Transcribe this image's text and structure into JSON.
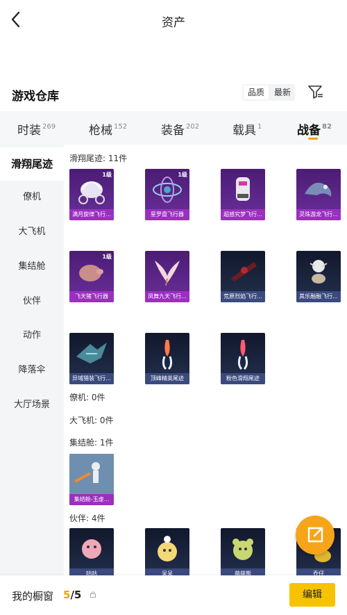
{
  "header": {
    "title": "资产"
  },
  "warehouse": {
    "title": "游戏仓库",
    "sort_quality": "品质",
    "sort_latest": "最新"
  },
  "tabs": [
    {
      "label": "时装",
      "count": "269"
    },
    {
      "label": "枪械",
      "count": "152"
    },
    {
      "label": "装备",
      "count": "202"
    },
    {
      "label": "载具",
      "count": "1"
    },
    {
      "label": "战备",
      "count": "82"
    }
  ],
  "sidebar": [
    {
      "label": "滑翔尾迹"
    },
    {
      "label": "僚机"
    },
    {
      "label": "大飞机"
    },
    {
      "label": "集结舱"
    },
    {
      "label": "伙伴"
    },
    {
      "label": "动作"
    },
    {
      "label": "降落伞"
    },
    {
      "label": "大厅场景"
    }
  ],
  "sections": {
    "glide_trail": "滑翔尾迹: 11件",
    "wingman": "僚机: 0件",
    "big_plane": "大飞机: 0件",
    "assembly_pod": "集结舱: 1件",
    "partner": "伙伴: 4件"
  },
  "items": [
    {
      "name": "满月旋律飞行...",
      "level": "1级"
    },
    {
      "name": "星罗盘飞行器",
      "level": "1级"
    },
    {
      "name": "超感究梦飞行...",
      "level": ""
    },
    {
      "name": "灵珠游龙飞行...",
      "level": ""
    },
    {
      "name": "飞天猪飞行器",
      "level": "1级"
    },
    {
      "name": "凤舞九天飞行...",
      "level": ""
    },
    {
      "name": "荒原烈焰飞行...",
      "level": ""
    },
    {
      "name": "其乐融融飞行...",
      "level": ""
    },
    {
      "name": "异域猎装飞行...",
      "level": ""
    },
    {
      "name": "顶峰精英尾迹",
      "level": ""
    },
    {
      "name": "粉色滑翔尾迹",
      "level": ""
    },
    {
      "name": "集结舱-玉虚...",
      "level": ""
    },
    {
      "name": "咕咕",
      "level": ""
    },
    {
      "name": "呆呆",
      "level": ""
    },
    {
      "name": "萌萌熊",
      "level": ""
    },
    {
      "name": "乔仔",
      "level": ""
    }
  ],
  "bottom": {
    "showcase_label": "我的橱窗",
    "showcase_current": "5",
    "showcase_total": "/5",
    "edit_label": "编辑"
  },
  "colors": {
    "accent": "#f5a100",
    "edit_button": "#f7c300",
    "fab": "#f6a51a",
    "card_purple": "#9b2fc0",
    "card_blue": "#3b4a7e"
  }
}
